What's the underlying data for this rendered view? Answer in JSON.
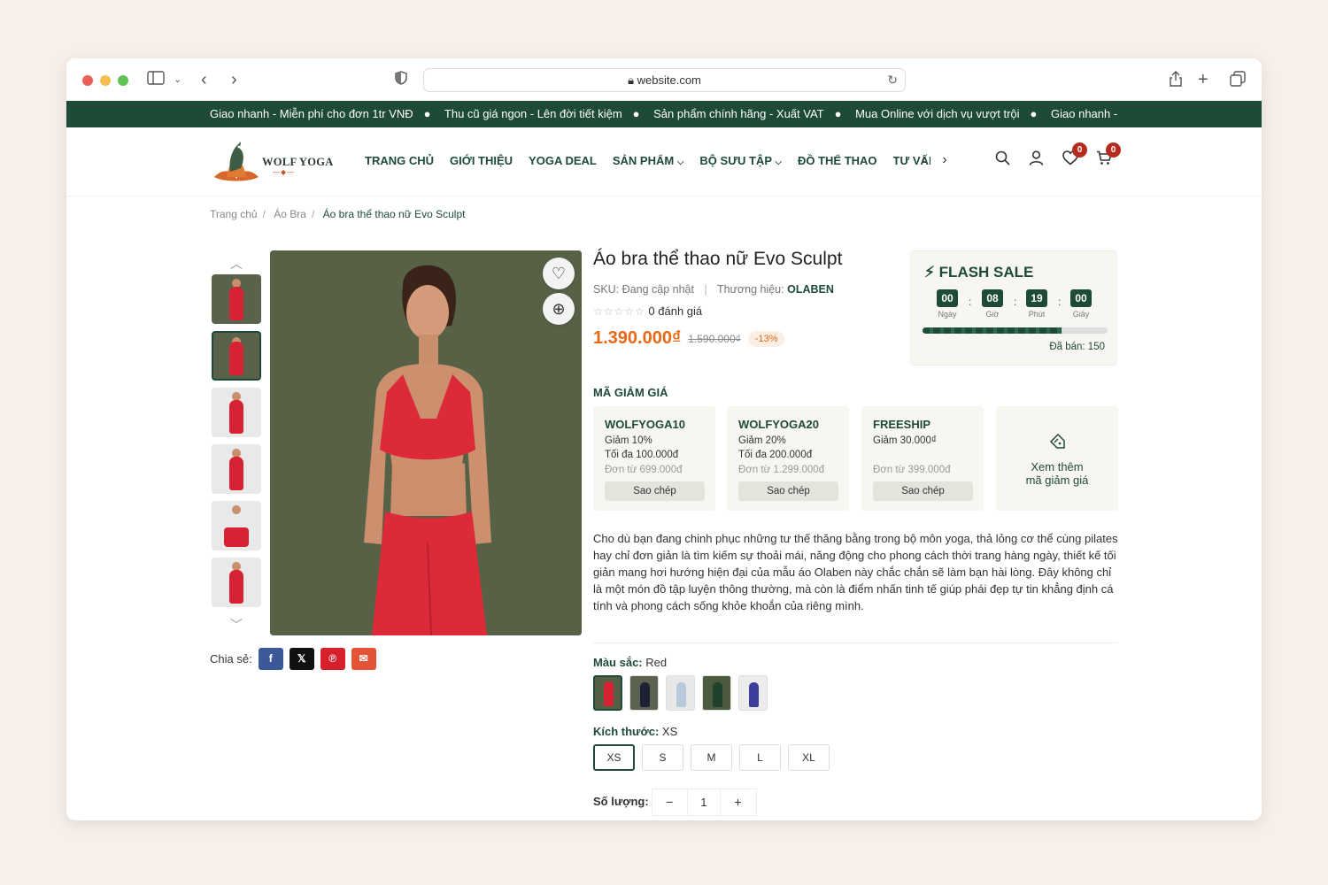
{
  "browser": {
    "url": "website.com"
  },
  "announcement": [
    "Giao nhanh - Miễn phí cho đơn 1tr VNĐ",
    "Thu cũ giá ngon - Lên đời tiết kiệm",
    "Sản phẩm chính hãng - Xuất VAT",
    "Mua Online với dịch vụ vượt trội",
    "Giao nhanh -"
  ],
  "logo": {
    "text": "WOLF YOGA"
  },
  "nav": {
    "items": [
      "TRANG CHỦ",
      "GIỚI THIỆU",
      "YOGA DEAL",
      "SẢN PHẨM",
      "BỘ SƯU TẬP",
      "ĐỒ THỂ THAO",
      "TƯ VẤN"
    ],
    "wishlist_count": "0",
    "cart_count": "0"
  },
  "breadcrumb": {
    "home": "Trang chủ",
    "category": "Áo Bra",
    "current": "Áo bra thể thao nữ Evo Sculpt"
  },
  "product": {
    "title": "Áo bra thể thao nữ Evo Sculpt",
    "sku_label": "SKU:",
    "sku": "Đang cập nhật",
    "brand_label": "Thương hiệu:",
    "brand": "OLABEN",
    "rating_text": "0 đánh giá",
    "price": "1.390.000₫",
    "old_price": "1.590.000₫",
    "discount": "-13%",
    "description": "Cho dù bạn đang chinh phục những tư thế thăng bằng trong bộ môn yoga, thả lỏng cơ thể cùng pilates hay chỉ đơn giản là tìm kiếm sự thoải mái, năng động cho phong cách thời trang hàng ngày, thiết kế tối giản mang hơi hướng hiện đại của mẫu áo Olaben này chắc chắn sẽ làm bạn hài lòng. Đây không chỉ là một món đồ tập luyện thông thường, mà còn là điểm nhấn tinh tế giúp phái đẹp tự tin khẳng định cá tính và phong cách sống khỏe khoắn của riêng mình."
  },
  "flash_sale": {
    "title": "FLASH SALE",
    "countdown": [
      {
        "value": "00",
        "label": "Ngày"
      },
      {
        "value": "08",
        "label": "Giờ"
      },
      {
        "value": "19",
        "label": "Phút"
      },
      {
        "value": "00",
        "label": "Giây"
      }
    ],
    "sold_text": "Đã bán: 150",
    "progress_percent": 75
  },
  "coupons": {
    "label": "MÃ GIẢM GIÁ",
    "items": [
      {
        "code": "WOLFYOGA10",
        "line1": "Giảm 10%",
        "line2": "Tối đa 100.000đ",
        "line3": "Đơn từ 699.000đ",
        "button": "Sao chép"
      },
      {
        "code": "WOLFYOGA20",
        "line1": "Giảm 20%",
        "line2": "Tối đa 200.000đ",
        "line3": "Đơn từ 1.299.000đ",
        "button": "Sao chép"
      },
      {
        "code": "FREESHIP",
        "line1": "Giảm 30.000₫",
        "line2": "",
        "line3": "Đơn từ 399.000đ",
        "button": "Sao chép"
      }
    ],
    "more_line1": "Xem thêm",
    "more_line2": "mã giảm giá"
  },
  "share": {
    "label": "Chia sẻ:"
  },
  "color": {
    "label": "Màu sắc:",
    "value": "Red",
    "swatches": [
      "#d82234",
      "#1c2233",
      "#b9c9dc",
      "#20402c",
      "#3b3f9a"
    ]
  },
  "size": {
    "label": "Kích thước:",
    "value": "XS",
    "options": [
      "XS",
      "S",
      "M",
      "L",
      "XL"
    ]
  },
  "quantity": {
    "label": "Số lượng:",
    "value": "1"
  }
}
